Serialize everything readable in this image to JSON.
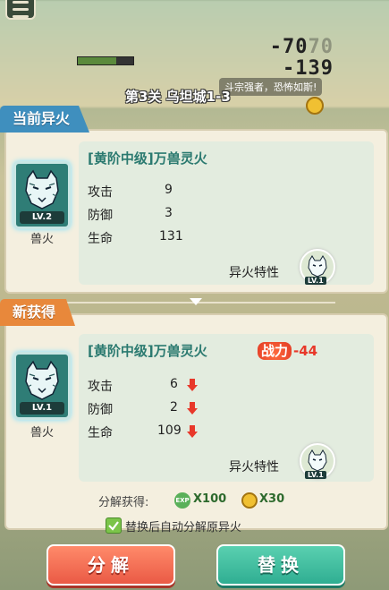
{
  "battle": {
    "damage_1": "-70",
    "damage_1_faded": "70",
    "damage_2": "-139",
    "level_title": "第3关 乌坦城1-3",
    "speech": "斗宗强者，恐怖如斯!"
  },
  "current": {
    "tab_label": "当前异火",
    "icon_level": "LV.2",
    "icon_name": "兽火",
    "title": "[黄阶中级]万兽灵火",
    "stats": [
      {
        "label": "攻击",
        "value": "9"
      },
      {
        "label": "防御",
        "value": "3"
      },
      {
        "label": "生命",
        "value": "131"
      }
    ],
    "trait_label": "异火特性",
    "trait_level": "LV.1"
  },
  "newly": {
    "tab_label": "新获得",
    "icon_level": "LV.1",
    "icon_name": "兽火",
    "title": "[黄阶中级]万兽灵火",
    "power_label": "战力",
    "power_value": "-44",
    "stats": [
      {
        "label": "攻击",
        "value": "6"
      },
      {
        "label": "防御",
        "value": "2"
      },
      {
        "label": "生命",
        "value": "109"
      }
    ],
    "trait_label": "异火特性",
    "trait_level": "LV.1"
  },
  "reward": {
    "label": "分解获得:",
    "exp_icon_text": "EXP",
    "exp_amount": "X100",
    "coin_amount": "X30"
  },
  "auto_option": {
    "label": "替换后自动分解原异火",
    "checked": true
  },
  "buttons": {
    "decompose": "分解",
    "replace": "替换"
  },
  "colors": {
    "tab_current": "#3f8fbe",
    "tab_new": "#e8883b",
    "title_text": "#2b7a70",
    "down_arrow": "#e8382a",
    "button_decompose": "#ea5a45",
    "button_replace": "#2fae92"
  }
}
